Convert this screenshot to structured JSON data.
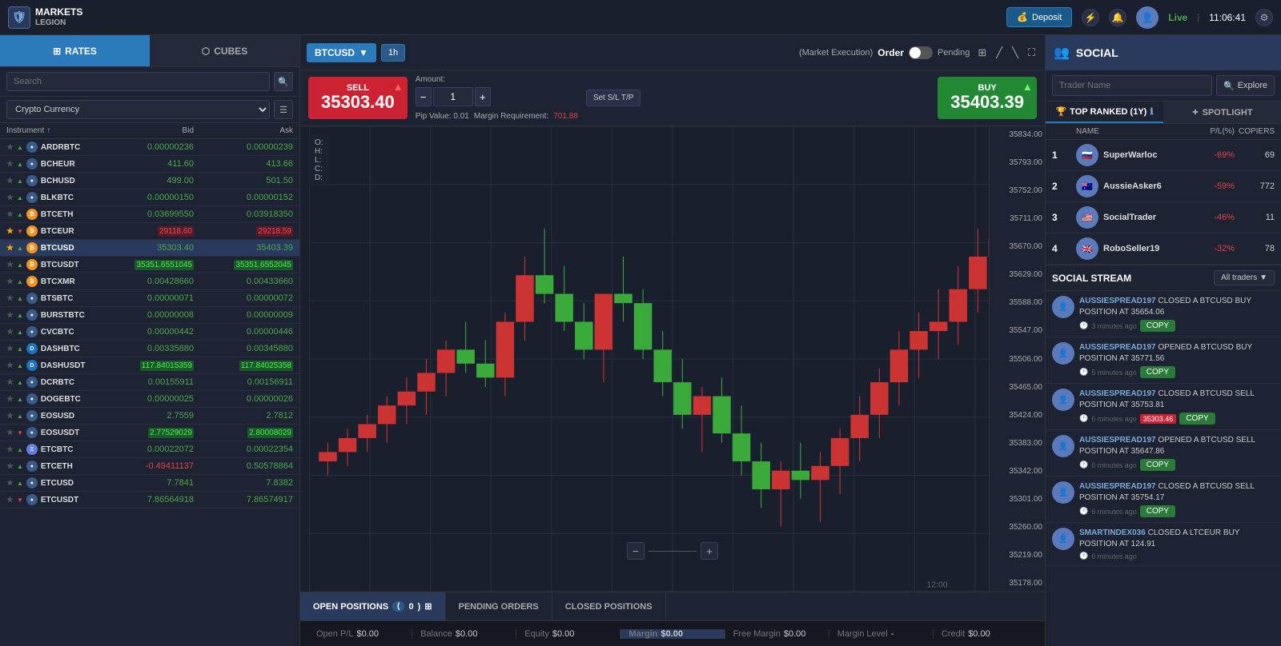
{
  "app": {
    "logo_top": "MARKETS",
    "logo_bottom": "LEGION",
    "time": "11:06:41",
    "live_label": "Live",
    "deposit_label": "Deposit"
  },
  "left_panel": {
    "tab_rates": "RATES",
    "tab_cubes": "CUBES",
    "search_placeholder": "Search",
    "filter_label": "Crypto Currency",
    "header_instrument": "Instrument",
    "header_bid": "Bid",
    "header_ask": "Ask",
    "instruments": [
      {
        "name": "ARDRBTC",
        "bid": "0.00000236",
        "ask": "0.00000239",
        "bid_color": "green",
        "ask_color": "green",
        "icon": "world",
        "star": false,
        "trend": "up"
      },
      {
        "name": "BCHEUR",
        "bid": "411.60",
        "ask": "413.66",
        "bid_color": "green",
        "ask_color": "green",
        "icon": "world",
        "star": false,
        "trend": "up"
      },
      {
        "name": "BCHUSD",
        "bid": "499.00",
        "ask": "501.50",
        "bid_color": "green",
        "ask_color": "green",
        "icon": "world",
        "star": false,
        "trend": "up"
      },
      {
        "name": "BLKBTC",
        "bid": "0.00000150",
        "ask": "0.00000152",
        "bid_color": "green",
        "ask_color": "green",
        "icon": "world",
        "star": false,
        "trend": "up"
      },
      {
        "name": "BTCETH",
        "bid": "0.03699550",
        "ask": "0.03918350",
        "bid_color": "green",
        "ask_color": "green",
        "icon": "btc",
        "star": false,
        "trend": "up"
      },
      {
        "name": "BTCEUR",
        "bid": "29118.60",
        "ask": "29218.59",
        "bid_color": "red",
        "ask_color": "red",
        "icon": "btc",
        "star": true,
        "trend": "down",
        "highlight_bid": "red",
        "highlight_ask": "red"
      },
      {
        "name": "BTCUSD",
        "bid": "35303.40",
        "ask": "35403.39",
        "bid_color": "green",
        "ask_color": "green",
        "icon": "btc",
        "star": true,
        "trend": "up",
        "active": true
      },
      {
        "name": "BTCUSDT",
        "bid": "35351.6551045",
        "ask": "35351.6552045",
        "bid_color": "green",
        "ask_color": "green",
        "icon": "btc",
        "star": false,
        "trend": "up",
        "highlight_bid": "green",
        "highlight_ask": "green"
      },
      {
        "name": "BTCXMR",
        "bid": "0.00428660",
        "ask": "0.00433660",
        "bid_color": "green",
        "ask_color": "green",
        "icon": "btc",
        "star": false,
        "trend": "up"
      },
      {
        "name": "BTSBTC",
        "bid": "0.00000071",
        "ask": "0.00000072",
        "bid_color": "green",
        "ask_color": "green",
        "icon": "world",
        "star": false,
        "trend": "up"
      },
      {
        "name": "BURSTBTC",
        "bid": "0.00000008",
        "ask": "0.00000009",
        "bid_color": "green",
        "ask_color": "green",
        "icon": "world",
        "star": false,
        "trend": "up"
      },
      {
        "name": "CVCBTC",
        "bid": "0.00000442",
        "ask": "0.00000446",
        "bid_color": "green",
        "ask_color": "green",
        "icon": "world",
        "star": false,
        "trend": "up"
      },
      {
        "name": "DASHBTC",
        "bid": "0.00335880",
        "ask": "0.00345880",
        "bid_color": "green",
        "ask_color": "green",
        "icon": "dash",
        "star": false,
        "trend": "up"
      },
      {
        "name": "DASHUSDT",
        "bid": "117.84015359",
        "ask": "117.84025358",
        "bid_color": "green",
        "ask_color": "green",
        "icon": "dash",
        "star": false,
        "trend": "up",
        "highlight_bid": "green",
        "highlight_ask": "green"
      },
      {
        "name": "DCRBTC",
        "bid": "0.00155911",
        "ask": "0.00156911",
        "bid_color": "green",
        "ask_color": "green",
        "icon": "world",
        "star": false,
        "trend": "up"
      },
      {
        "name": "DOGEBTC",
        "bid": "0.00000025",
        "ask": "0.00000026",
        "bid_color": "green",
        "ask_color": "green",
        "icon": "world",
        "star": false,
        "trend": "up"
      },
      {
        "name": "EOSUSD",
        "bid": "2.7559",
        "ask": "2.7812",
        "bid_color": "green",
        "ask_color": "green",
        "icon": "world",
        "star": false,
        "trend": "up"
      },
      {
        "name": "EOSUSDT",
        "bid": "2.77529029",
        "ask": "2.80008029",
        "bid_color": "green",
        "ask_color": "green",
        "icon": "world",
        "star": false,
        "trend": "down",
        "highlight_bid": "green",
        "highlight_ask": "green"
      },
      {
        "name": "ETCBTC",
        "bid": "0.00022072",
        "ask": "0.00022354",
        "bid_color": "green",
        "ask_color": "green",
        "icon": "eth",
        "star": false,
        "trend": "up"
      },
      {
        "name": "ETCETH",
        "bid": "-0.49411137",
        "ask": "0.50578864",
        "bid_color": "red",
        "ask_color": "green",
        "icon": "world",
        "star": false,
        "trend": "up"
      },
      {
        "name": "ETCUSD",
        "bid": "7.7841",
        "ask": "7.8382",
        "bid_color": "green",
        "ask_color": "green",
        "icon": "world",
        "star": false,
        "trend": "up"
      },
      {
        "name": "ETCUSDT",
        "bid": "7.86564918",
        "ask": "7.86574917",
        "bid_color": "green",
        "ask_color": "green",
        "icon": "world",
        "star": false,
        "trend": "down"
      }
    ]
  },
  "chart": {
    "symbol": "BTCUSD",
    "timeframe": "1h",
    "market_exec": "(Market Execution)",
    "order_label": "Order",
    "pending_label": "Pending",
    "sell_label": "SELL",
    "sell_price": "35303.40",
    "buy_label": "BUY",
    "buy_price": "35403.39",
    "amount_label": "Amount:",
    "amount_value": "1",
    "sl_tp_label": "Set S/L T/P",
    "pip_label": "Pip Value: 0.01",
    "margin_label": "Margin Requirement:",
    "margin_value": "701.88",
    "ohlc": {
      "o": "O:",
      "h": "H:",
      "l": "L:",
      "c": "C:",
      "d": "D:"
    },
    "price_levels": [
      "35834.00",
      "35793.00",
      "35752.00",
      "35711.00",
      "35670.00",
      "35629.00",
      "35588.00",
      "35547.00",
      "35506.00",
      "35465.00",
      "35424.00",
      "35383.00",
      "35342.00",
      "35301.00",
      "35260.00",
      "35219.00",
      "35178.00"
    ],
    "time_label": "12:00"
  },
  "bottom_tabs": {
    "open_positions": "OPEN POSITIONS",
    "open_count": "0",
    "pending_orders": "PENDING ORDERS",
    "closed_positions": "CLOSED POSITIONS"
  },
  "status_bar": {
    "open_pl_label": "Open P/L",
    "open_pl_value": "$0.00",
    "balance_label": "Balance",
    "balance_value": "$0.00",
    "equity_label": "Equity",
    "equity_value": "$0.00",
    "margin_label": "Margin",
    "margin_value": "$0.00",
    "free_margin_label": "Free Margin",
    "free_margin_value": "$0.00",
    "margin_level_label": "Margin Level",
    "margin_level_value": "-",
    "credit_label": "Credit",
    "credit_value": "$0.00"
  },
  "social": {
    "title": "SOCIAL",
    "search_placeholder": "Trader Name",
    "explore_label": "Explore",
    "tab_ranked": "TOP RANKED (1Y)",
    "tab_spotlight": "SPOTLIGHT",
    "header_name": "NAME",
    "header_pl": "P/L(%)",
    "header_copiers": "COPIERS",
    "traders": [
      {
        "rank": "1",
        "name": "SuperWarloc",
        "pl": "-69%",
        "pl_color": "red",
        "copiers": "69",
        "flag": "🇷🇺"
      },
      {
        "rank": "2",
        "name": "AussieAsker6",
        "pl": "-59%",
        "pl_color": "red",
        "copiers": "772",
        "flag": "🇦🇺"
      },
      {
        "rank": "3",
        "name": "SocialTrader",
        "pl": "-46%",
        "pl_color": "red",
        "copiers": "11",
        "flag": "🇺🇸"
      },
      {
        "rank": "4",
        "name": "RoboSeller19",
        "pl": "-32%",
        "pl_color": "red",
        "copiers": "78",
        "flag": "🇬🇧"
      }
    ],
    "stream_title": "SOCIAL STREAM",
    "all_traders_label": "All traders",
    "stream_items": [
      {
        "trader": "AUSSIESPREAD197",
        "action": "CLOSED A BTCUSD BUY POSITION AT 35654.06",
        "time": "3 minutes ago",
        "has_copy": true,
        "price_tag": null
      },
      {
        "trader": "AUSSIESPREAD197",
        "action": "OPENED A BTCUSD BUY POSITION AT 35771.56",
        "time": "5 minutes ago",
        "has_copy": true,
        "price_tag": null
      },
      {
        "trader": "AUSSIESPREAD197",
        "action": "CLOSED A BTCUSD SELL POSITION AT 35753.81",
        "time": "6 minutes ago",
        "has_copy": true,
        "price_tag": "35303.46"
      },
      {
        "trader": "AUSSIESPREAD197",
        "action": "OPENED A BTCUSD SELL POSITION AT 35647.86",
        "time": "6 minutes ago",
        "has_copy": true,
        "price_tag": null
      },
      {
        "trader": "AUSSIESPREAD197",
        "action": "CLOSED A BTCUSD SELL POSITION AT 35754.17",
        "time": "6 minutes ago",
        "has_copy": true,
        "price_tag": null
      },
      {
        "trader": "SMARTINDEX036",
        "action": "CLOSED A LTCEUR BUY POSITION AT 124.91",
        "time": "6 minutes ago",
        "has_copy": false,
        "price_tag": null
      }
    ]
  }
}
